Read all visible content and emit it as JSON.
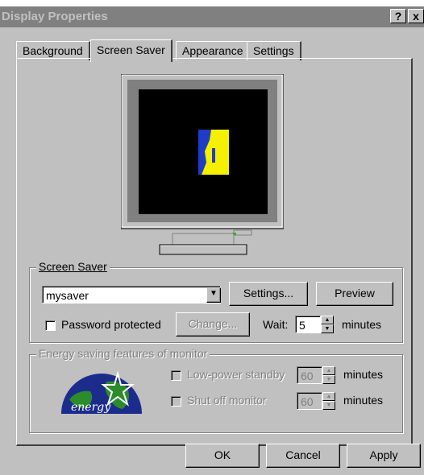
{
  "window": {
    "title": "Display Properties",
    "help_button": "?",
    "close_button": "x"
  },
  "tabs": [
    {
      "label": "Background"
    },
    {
      "label": "Screen Saver"
    },
    {
      "label": "Appearance"
    },
    {
      "label": "Settings"
    }
  ],
  "screen_saver": {
    "group_label": "Screen Saver",
    "selected": "mysaver",
    "settings_button": "Settings...",
    "preview_button": "Preview",
    "password_label": "Password protected",
    "password_checked": false,
    "change_button": "Change...",
    "wait_label": "Wait:",
    "wait_value": "5",
    "wait_unit": "minutes"
  },
  "energy": {
    "group_label": "Energy saving features of monitor",
    "logo_text": "energy",
    "low_power_label": "Low-power standby",
    "low_power_value": "60",
    "low_power_unit": "minutes",
    "shut_off_label": "Shut off monitor",
    "shut_off_value": "60",
    "shut_off_unit": "minutes"
  },
  "buttons": {
    "ok": "OK",
    "cancel": "Cancel",
    "apply": "Apply"
  },
  "colors": {
    "titlebar": "#808080",
    "face": "#c0c0c0",
    "preview_bg": "#000000",
    "energy_blue": "#1c2c8c",
    "energy_green": "#2c8c2c"
  }
}
